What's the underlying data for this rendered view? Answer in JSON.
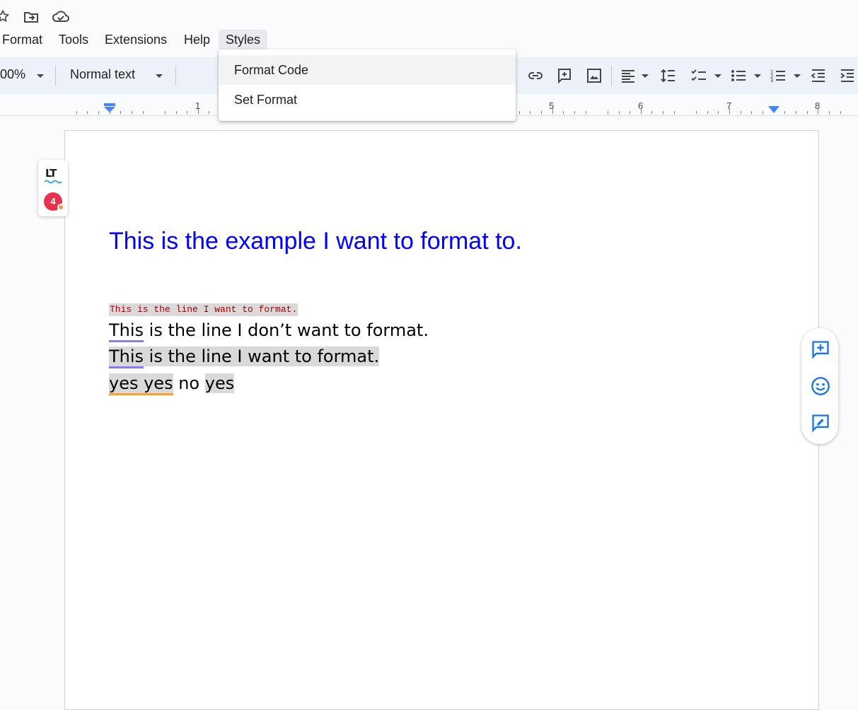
{
  "menubar": {
    "items": [
      "Format",
      "Tools",
      "Extensions",
      "Help",
      "Styles"
    ]
  },
  "toolbar": {
    "zoom": "00%",
    "style": "Normal text"
  },
  "ruler": {
    "numbers": [
      "1",
      "5",
      "6",
      "7",
      "8"
    ]
  },
  "styles_menu": {
    "items": [
      "Format Code",
      "Set Format"
    ]
  },
  "document": {
    "heading": "This is the example I want to format to.",
    "code_line": "This is the line I want to format.",
    "line1": {
      "part1": "This",
      "part2": " is the line I don’t want to format."
    },
    "line2": {
      "part1": "This",
      "part2": " is the line I want to format."
    },
    "line3": {
      "part1": "yes yes",
      "part2": " no ",
      "part3": "yes"
    }
  },
  "languagetool": {
    "logo": "LT",
    "issue_count": "4"
  },
  "colors": {
    "heading": "#0000ff",
    "code": "#980000",
    "highlight": "#d9d9d9",
    "accent": "#1a73e8"
  }
}
